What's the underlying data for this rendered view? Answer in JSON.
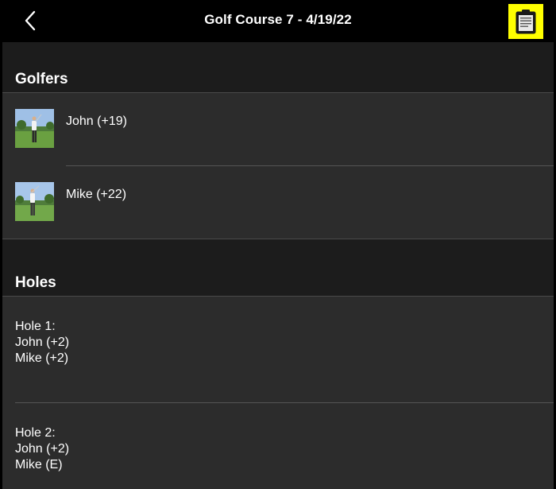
{
  "navbar": {
    "title": "Golf Course 7 - 4/19/22",
    "back_icon": "chevron-left-icon",
    "action_icon": "clipboard-icon",
    "action_highlight_color": "#ffff00"
  },
  "golfers_section": {
    "title": "Golfers",
    "golfers": [
      {
        "name": "John (+19)",
        "avatar_icon": "golfer-photo"
      },
      {
        "name": "Mike (+22)",
        "avatar_icon": "golfer-photo"
      }
    ]
  },
  "holes_section": {
    "title": "Holes",
    "holes": [
      {
        "label": "Hole 1:",
        "scores": [
          "John (+2)",
          "Mike (+2)"
        ]
      },
      {
        "label": "Hole 2:",
        "scores": [
          "John (+2)",
          "Mike (E)"
        ]
      }
    ]
  },
  "colors": {
    "background": "#000000",
    "section_background": "#1c1c1c",
    "row_background": "#2c2c2c",
    "text": "#ffffff"
  }
}
